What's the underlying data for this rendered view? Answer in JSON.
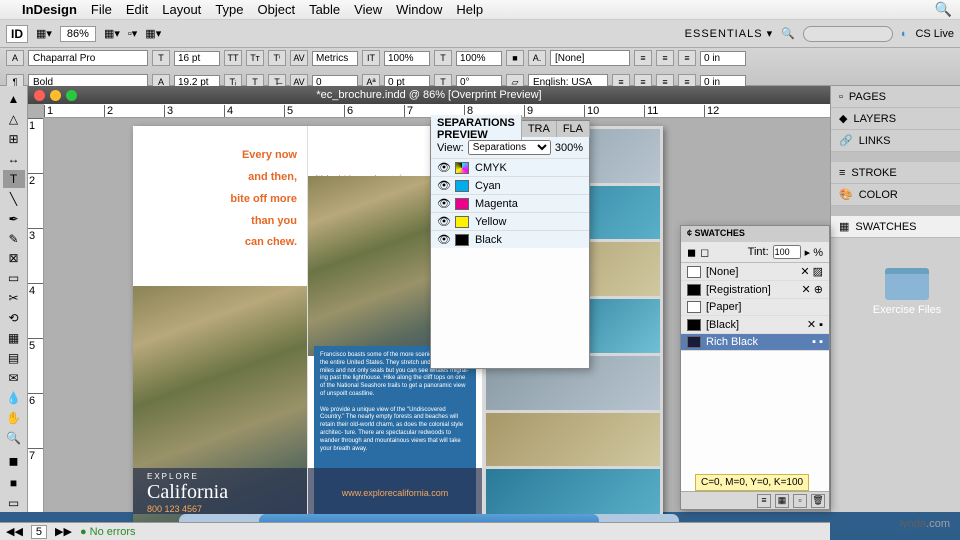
{
  "menu": {
    "app": "InDesign",
    "items": [
      "File",
      "Edit",
      "Layout",
      "Type",
      "Object",
      "Table",
      "View",
      "Window",
      "Help"
    ]
  },
  "toolbar1": {
    "zoom": "86%",
    "workspace": "ESSENTIALS ▾",
    "cslive": "CS Live"
  },
  "control": {
    "font": "Chaparral Pro",
    "style": "Bold",
    "size": "16 pt",
    "leading": "19.2 pt",
    "tracking": "0",
    "scale": "100%",
    "charstyle": "[None]",
    "lang": "English: USA",
    "indent": "0 in"
  },
  "doc": {
    "title": "*ec_brochure.indd @ 86% [Overprint Preview]"
  },
  "headline": {
    "l1": "Every now",
    "l2": "and then,",
    "l3": "bite off more",
    "l4": "than you",
    "l5": "can chew."
  },
  "bodytext": "We handpick every element of to create a journey that will li your memories forever. We mak everything is perfect, so all yo to worry about is savoring the adventure of a lifetime. Wande marbled desert rock, leave foot in creamy sand dunes, watch w/ migrate along unspoilt stretch beach and refresh your senses i fragrant redwood forests. Trav like-minded people on the greatest adventure in this iconic landscape.",
  "cal": {
    "explore": "EXPLORE",
    "name": "California",
    "phone": "800 123 4567",
    "url": "www.explorecalifornia.com"
  },
  "sep": {
    "title": "SEPARATIONS PREVIEW",
    "tab2": "TRA",
    "tab3": "FLA",
    "view": "View:",
    "mode": "Separations",
    "pct": "300%",
    "inks": [
      "CMYK",
      "Cyan",
      "Magenta",
      "Yellow",
      "Black"
    ]
  },
  "swatches": {
    "title": "¢ SWATCHES",
    "tint": "Tint:",
    "tintval": "100",
    "rows": [
      "[None]",
      "[Registration]",
      "[Paper]",
      "[Black]",
      "Rich Black"
    ],
    "tip": "C=0, M=0, Y=0, K=100"
  },
  "dock": {
    "items": [
      "PAGES",
      "LAYERS",
      "LINKS",
      "STROKE",
      "COLOR",
      "SWATCHES"
    ]
  },
  "status": {
    "page": "5",
    "errors": "No errors"
  },
  "exercise": "Exercise Files",
  "watermark": {
    "a": "lynda",
    "b": ".com"
  }
}
